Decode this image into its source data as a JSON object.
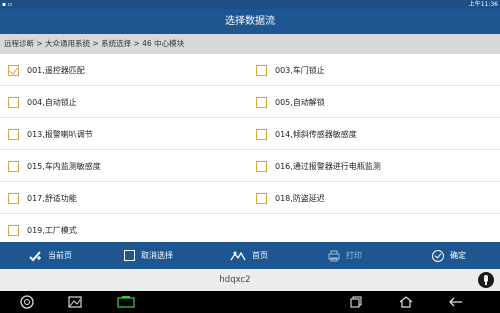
{
  "status": {
    "right_text": "上午11:36"
  },
  "title": "选择数据流",
  "breadcrumb": "远程诊断 > 大众通用系统 > 系统选择 > 46 中心模块",
  "items": [
    {
      "label": "001,遥控器匹配",
      "checked": true
    },
    {
      "label": "003,车门锁止",
      "checked": false
    },
    {
      "label": "004,自动锁止",
      "checked": false
    },
    {
      "label": "005,自动解锁",
      "checked": false
    },
    {
      "label": "013,报警喇叭调节",
      "checked": false
    },
    {
      "label": "014,倾斜传感器敏感度",
      "checked": false
    },
    {
      "label": "015,车内监测敏感度",
      "checked": false
    },
    {
      "label": "016,通过报警器进行电瓶监测",
      "checked": false
    },
    {
      "label": "017,舒适功能",
      "checked": false
    },
    {
      "label": "018,防盗延迟",
      "checked": false
    },
    {
      "label": "019,工厂模式",
      "checked": false
    }
  ],
  "toolbar": {
    "current_page": "当前页",
    "deselect": "取消选择",
    "first_page": "首页",
    "print": "打印",
    "confirm": "确定"
  },
  "input": {
    "value": "hdqxc2"
  },
  "colors": {
    "primary": "#1d5690",
    "checkbox": "#d9a441",
    "breadcrumb_bg": "#d8d8d8"
  }
}
